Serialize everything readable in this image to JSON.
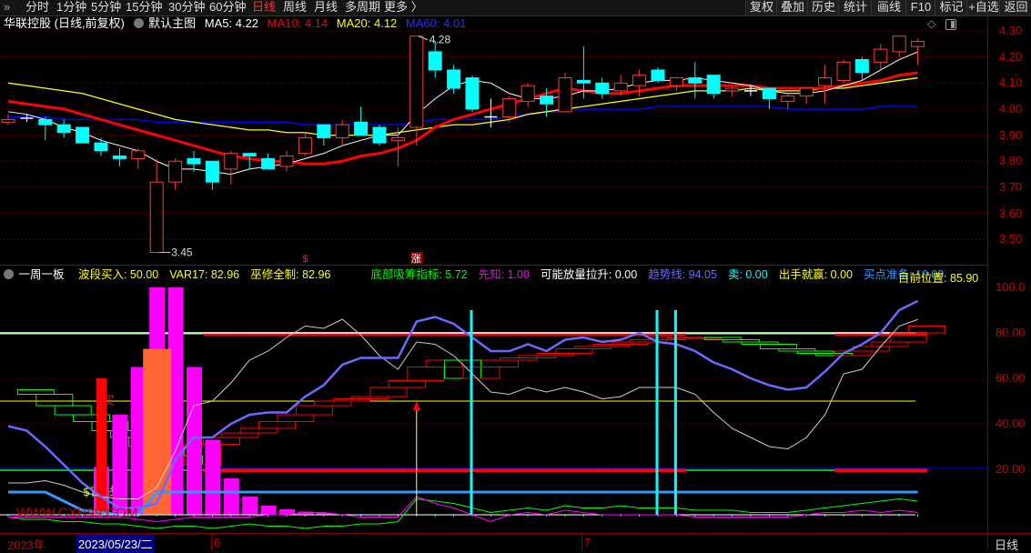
{
  "toolbar": {
    "periods": [
      "分时",
      "1分钟",
      "5分钟",
      "15分钟",
      "30分钟",
      "60分钟",
      "日线",
      "周线",
      "月线",
      "多周期",
      "更多 〉"
    ],
    "active_period": "日线",
    "buttons": [
      "复权",
      "叠加",
      "历史",
      "统计",
      "画线",
      "F10",
      "标记",
      "+自选",
      "返回"
    ]
  },
  "main_chart": {
    "title": "华联控股 (日线,前复权)",
    "template": "默认主图",
    "ma5": "MA5: 4.22",
    "ma10": "MA10: 4.14",
    "ma20": "MA20: 4.12",
    "ma60": "MA60: 4.01",
    "high_label": "4.28",
    "low_label": "3.45",
    "markers": {
      "dollar": "$",
      "limit_up": "涨"
    },
    "price_axis": [
      "4.30",
      "4.20",
      "4.10",
      "4.00",
      "3.90",
      "3.80",
      "3.70",
      "3.60",
      "3.50"
    ]
  },
  "indicator": {
    "name": "一周一板",
    "items": [
      {
        "text": "波段买入: 50.00",
        "color": "#ffff00"
      },
      {
        "text": "VAR17: 82.96",
        "color": "#ffff00"
      },
      {
        "text": "巫修全制: 82.96",
        "color": "#ffff00"
      },
      {
        "text": "底部吸筹指标: 5.72",
        "color": "#00ff00"
      },
      {
        "text": "先知: 1.00",
        "color": "#ff00ff"
      },
      {
        "text": "可能放量拉升: 0.00",
        "color": "#ffffff"
      },
      {
        "text": "趋势线: 94.05",
        "color": "#6a6aff"
      },
      {
        "text": "卖: 0.00",
        "color": "#00ffff"
      },
      {
        "text": "出手就赢: 0.00",
        "color": "#ffff00"
      },
      {
        "text": "买点准备: 10.00",
        "color": "#3399ff"
      }
    ],
    "position": "目前位置: 85.90",
    "axis": [
      "100.0",
      "80.00",
      "60.00",
      "40.00",
      "20.00"
    ],
    "labels": {
      "buy": "买",
      "signal_a": "$首",
      "signal_b": "钱",
      "watermark": "WWW.CXH99.COM"
    }
  },
  "bottom_axis": {
    "year": "2023年",
    "cursor_date": "2023/05/23/二",
    "month6": "6",
    "month7": "7",
    "period": "日线"
  },
  "colors": {
    "up": "#ff3b3b",
    "down": "#00ffff",
    "ma5": "#ffffff",
    "ma10": "#ff0000",
    "ma20": "#ffff00",
    "ma60": "#0000ff",
    "axis": "#c00000",
    "trend": "#6a6aff",
    "buyprep": "#3399ff",
    "magenta": "#ff00ff",
    "orange": "#ff6633"
  },
  "chart_data": {
    "type": "candlestick",
    "price_range": [
      3.45,
      4.3
    ],
    "ohlc": [
      [
        3.95,
        3.98,
        3.94,
        3.96
      ],
      [
        3.965,
        3.98,
        3.95,
        3.965
      ],
      [
        3.96,
        3.97,
        3.88,
        3.94
      ],
      [
        3.94,
        3.96,
        3.89,
        3.91
      ],
      [
        3.93,
        3.93,
        3.87,
        3.87
      ],
      [
        3.87,
        3.89,
        3.82,
        3.84
      ],
      [
        3.82,
        3.85,
        3.78,
        3.81
      ],
      [
        3.81,
        3.85,
        3.77,
        3.84
      ],
      [
        3.45,
        3.81,
        3.45,
        3.72
      ],
      [
        3.72,
        3.81,
        3.69,
        3.8
      ],
      [
        3.81,
        3.84,
        3.76,
        3.79
      ],
      [
        3.8,
        3.8,
        3.69,
        3.72
      ],
      [
        3.77,
        3.84,
        3.71,
        3.83
      ],
      [
        3.83,
        3.83,
        3.77,
        3.82
      ],
      [
        3.81,
        3.83,
        3.77,
        3.77
      ],
      [
        3.78,
        3.84,
        3.76,
        3.82
      ],
      [
        3.83,
        3.91,
        3.82,
        3.89
      ],
      [
        3.94,
        3.94,
        3.86,
        3.89
      ],
      [
        3.89,
        3.96,
        3.86,
        3.94
      ],
      [
        3.95,
        4.01,
        3.9,
        3.9
      ],
      [
        3.93,
        3.94,
        3.86,
        3.87
      ],
      [
        3.88,
        3.93,
        3.78,
        3.89
      ],
      [
        3.93,
        4.28,
        3.86,
        4.28
      ],
      [
        4.22,
        4.26,
        4.12,
        4.15
      ],
      [
        4.15,
        4.17,
        4.06,
        4.08
      ],
      [
        4.12,
        4.13,
        3.99,
        4.0
      ],
      [
        3.97,
        4.04,
        3.93,
        3.97
      ],
      [
        3.97,
        4.05,
        3.95,
        4.04
      ],
      [
        4.03,
        4.1,
        4.01,
        4.09
      ],
      [
        4.05,
        4.08,
        3.97,
        4.02
      ],
      [
        3.99,
        4.14,
        3.99,
        4.12
      ],
      [
        4.11,
        4.24,
        4.04,
        4.1
      ],
      [
        4.1,
        4.12,
        4.04,
        4.06
      ],
      [
        4.07,
        4.13,
        4.05,
        4.1
      ],
      [
        4.09,
        4.15,
        4.05,
        4.13
      ],
      [
        4.15,
        4.16,
        4.1,
        4.11
      ],
      [
        4.09,
        4.12,
        4.07,
        4.12
      ],
      [
        4.12,
        4.18,
        4.04,
        4.1
      ],
      [
        4.13,
        4.13,
        4.04,
        4.06
      ],
      [
        4.07,
        4.09,
        4.05,
        4.08
      ],
      [
        4.07,
        4.09,
        4.05,
        4.07
      ],
      [
        4.08,
        4.08,
        4.0,
        4.04
      ],
      [
        4.03,
        4.06,
        4.0,
        4.05
      ],
      [
        4.05,
        4.08,
        4.02,
        4.08
      ],
      [
        4.09,
        4.17,
        4.02,
        4.12
      ],
      [
        4.11,
        4.19,
        4.1,
        4.18
      ],
      [
        4.19,
        4.2,
        4.11,
        4.14
      ],
      [
        4.18,
        4.25,
        4.15,
        4.23
      ],
      [
        4.22,
        4.28,
        4.2,
        4.28
      ],
      [
        4.24,
        4.27,
        4.17,
        4.26
      ]
    ],
    "ma5": [
      3.99,
      3.98,
      3.96,
      3.93,
      3.91,
      3.88,
      3.86,
      3.84,
      3.8,
      3.77,
      3.77,
      3.76,
      3.75,
      3.77,
      3.78,
      3.79,
      3.81,
      3.83,
      3.86,
      3.88,
      3.9,
      3.9,
      3.98,
      4.04,
      4.09,
      4.11,
      4.1,
      4.06,
      4.04,
      4.04,
      4.05,
      4.07,
      4.07,
      4.08,
      4.1,
      4.11,
      4.11,
      4.12,
      4.11,
      4.1,
      4.09,
      4.07,
      4.06,
      4.06,
      4.07,
      4.09,
      4.11,
      4.15,
      4.19,
      4.22
    ],
    "ma10": [
      4.03,
      4.02,
      4.01,
      4.0,
      3.98,
      3.96,
      3.94,
      3.92,
      3.9,
      3.88,
      3.86,
      3.84,
      3.82,
      3.81,
      3.8,
      3.8,
      3.79,
      3.79,
      3.8,
      3.82,
      3.83,
      3.85,
      3.88,
      3.93,
      3.96,
      3.98,
      4.0,
      4.02,
      4.04,
      4.06,
      4.08,
      4.07,
      4.06,
      4.06,
      4.07,
      4.08,
      4.09,
      4.09,
      4.09,
      4.09,
      4.09,
      4.08,
      4.08,
      4.08,
      4.08,
      4.09,
      4.1,
      4.11,
      4.13,
      4.14
    ],
    "ma20": [
      4.1,
      4.09,
      4.08,
      4.07,
      4.06,
      4.04,
      4.02,
      4.0,
      3.98,
      3.96,
      3.95,
      3.94,
      3.93,
      3.92,
      3.92,
      3.91,
      3.91,
      3.9,
      3.9,
      3.9,
      3.9,
      3.91,
      3.92,
      3.93,
      3.94,
      3.94,
      3.95,
      3.96,
      3.98,
      3.99,
      4.0,
      4.01,
      4.02,
      4.03,
      4.04,
      4.05,
      4.06,
      4.07,
      4.07,
      4.07,
      4.08,
      4.07,
      4.07,
      4.07,
      4.08,
      4.08,
      4.09,
      4.1,
      4.11,
      4.12
    ],
    "ma60": [
      3.97,
      3.97,
      3.97,
      3.96,
      3.96,
      3.96,
      3.96,
      3.96,
      3.95,
      3.95,
      3.95,
      3.95,
      3.95,
      3.95,
      3.95,
      3.95,
      3.94,
      3.94,
      3.94,
      3.94,
      3.94,
      3.94,
      3.95,
      3.96,
      3.96,
      3.96,
      3.96,
      3.97,
      3.98,
      3.99,
      3.99,
      4.0,
      4.0,
      4.0,
      4.0,
      4.01,
      4.01,
      4.01,
      4.01,
      4.01,
      4.01,
      4.01,
      4.0,
      4.0,
      4.0,
      4.0,
      4.0,
      4.01,
      4.01,
      4.01
    ],
    "indicator_range": [
      0,
      100
    ],
    "trend": [
      39,
      37,
      30,
      22,
      14,
      8,
      3,
      3,
      5,
      24,
      34,
      34,
      40,
      44,
      45,
      45,
      52,
      57,
      66,
      69,
      69,
      69,
      85,
      87,
      84,
      78,
      72,
      72,
      75,
      72,
      77,
      78,
      76,
      77,
      80,
      76,
      75,
      72,
      67,
      64,
      60,
      57,
      55,
      56,
      63,
      71,
      75,
      80,
      90,
      94.05
    ],
    "position": [
      14,
      14,
      15,
      13,
      10,
      8,
      7,
      7,
      12,
      28,
      48,
      50,
      58,
      68,
      72,
      78,
      83,
      82,
      86,
      79,
      70,
      64,
      76,
      75,
      70,
      62,
      54,
      53,
      56,
      54,
      56,
      54,
      51,
      52,
      56,
      56,
      56,
      53,
      45,
      38,
      34,
      30,
      29,
      34,
      44,
      62,
      64,
      74,
      83,
      85.9
    ],
    "steps": [
      55,
      53,
      48,
      44,
      41,
      37,
      34,
      30,
      26,
      22,
      31,
      34,
      36,
      38,
      41,
      44,
      48,
      50,
      51,
      52,
      56,
      59,
      65,
      68,
      60,
      65,
      68,
      69,
      70,
      71,
      73,
      74,
      75,
      76,
      77,
      78,
      78,
      78,
      77,
      76,
      75,
      73,
      72,
      71,
      70,
      72,
      74,
      76,
      80,
      83
    ],
    "bars_magenta": [
      0,
      0,
      0,
      0,
      0,
      21,
      44,
      65,
      100,
      100,
      65,
      33,
      16,
      8,
      4,
      2.4,
      1.4,
      1,
      0,
      0,
      0,
      0,
      0,
      0,
      0,
      0,
      0,
      0,
      0,
      0,
      0,
      0,
      0,
      0,
      0,
      0,
      0,
      0,
      0,
      0,
      0,
      0,
      0,
      0,
      0,
      0,
      0,
      0,
      0,
      0
    ],
    "bar_red": {
      "index": 5,
      "value": 60
    },
    "bar_orange": {
      "index": 8,
      "value": 73
    },
    "buy_prep": [
      10,
      10,
      10,
      6,
      2,
      1,
      0,
      0,
      10,
      10,
      10,
      10,
      10,
      10,
      10,
      10,
      10,
      10,
      10,
      10,
      10,
      10,
      10,
      10,
      10,
      10,
      10,
      10,
      10,
      10,
      10,
      10,
      10,
      10,
      10,
      10,
      10,
      10,
      10,
      10,
      10,
      10,
      10,
      10,
      10,
      10,
      10,
      10,
      10,
      10
    ],
    "green_line": [
      -1,
      -2,
      -2,
      -3,
      -3,
      -4,
      -4,
      -5,
      -6,
      -5,
      -5,
      -6,
      -5,
      -4,
      -5,
      -5,
      -6,
      -5,
      -5,
      -4,
      -4,
      -3,
      7,
      6,
      5,
      3,
      1,
      2,
      3,
      2,
      4,
      3,
      3,
      4,
      3,
      3,
      3,
      2,
      2,
      2,
      1,
      1,
      1,
      2,
      3,
      4,
      5,
      6,
      7,
      6
    ],
    "magenta_line": [
      -1,
      -1,
      -1,
      -1,
      -1,
      -1,
      -1,
      -2,
      -3,
      -2,
      -1,
      -1,
      -1,
      -1,
      0,
      0,
      1,
      1,
      0,
      -1,
      -1,
      -1,
      8,
      5,
      3,
      0,
      -3,
      0,
      1,
      0,
      2,
      1,
      0,
      0,
      0,
      0,
      0,
      -1,
      -1,
      -1,
      -1,
      -1,
      -1,
      0,
      1,
      1,
      2,
      1,
      2,
      1
    ],
    "sell_signal_indices": [
      25,
      35,
      36
    ],
    "arrow_index": 22,
    "band_green_indices": [
      0,
      1,
      2,
      3,
      4,
      5,
      6,
      7,
      8,
      9,
      10,
      37,
      38,
      39,
      40,
      41,
      42,
      43,
      44
    ],
    "band_levels": [
      80,
      20
    ],
    "ref_lines": {
      "white": 80,
      "yellow": 50
    }
  }
}
